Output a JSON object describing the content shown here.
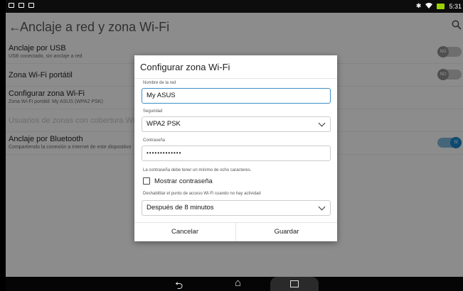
{
  "status_bar": {
    "time": "5:31",
    "icons": [
      "notification-icon",
      "notification-icon",
      "notification-icon",
      "bluetooth-icon",
      "wifi-icon",
      "battery-icon"
    ]
  },
  "action_bar": {
    "title": "Anclaje a red y zona Wi-Fi",
    "back_icon": "back-arrow-icon",
    "search_icon": "search-icon"
  },
  "settings": {
    "usb": {
      "title": "Anclaje por USB",
      "subtitle": "USB conectado, sin anclaje a red",
      "toggle": "NO"
    },
    "hotspot": {
      "title": "Zona Wi-Fi portátil",
      "toggle": "NO"
    },
    "configure": {
      "title": "Configurar zona Wi-Fi",
      "subtitle": "Zona Wi-Fi portátil: My ASUS (WPA2 PSK)"
    },
    "users": {
      "title": "Usuarios de zonas con cobertura Wi-Fi"
    },
    "bluetooth": {
      "title": "Anclaje por Bluetooth",
      "subtitle": "Compartiendo la conexión a Internet de este dispositivo",
      "toggle": "SÍ"
    }
  },
  "dialog": {
    "title": "Configurar zona Wi-Fi",
    "network_name_label": "Nombre de la red",
    "network_name_value": "My ASUS",
    "security_label": "Seguridad",
    "security_value": "WPA2 PSK",
    "password_label": "Contraseña",
    "password_value": "•••••••••••••",
    "password_hint": "La contraseña debe tener un mínimo de ocho caracteres.",
    "show_password_label": "Mostrar contraseña",
    "disable_label": "Deshabilitar el punto de acceso Wi-Fi cuando no hay actividad",
    "disable_value": "Después de 8 minutos",
    "cancel_label": "Cancelar",
    "save_label": "Guardar"
  },
  "nav_bar": {
    "icons": [
      "back-icon",
      "home-icon",
      "recents-icon"
    ]
  }
}
